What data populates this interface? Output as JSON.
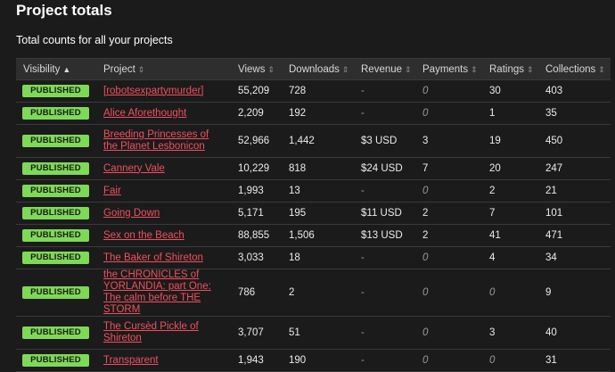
{
  "page": {
    "title": "Project totals",
    "subtitle": "Total counts for all your projects"
  },
  "columns": {
    "visibility": "Visibility",
    "project": "Project",
    "views": "Views",
    "downloads": "Downloads",
    "revenue": "Revenue",
    "payments": "Payments",
    "ratings": "Ratings",
    "collections": "Collections"
  },
  "rows": [
    {
      "status": "PUBLISHED",
      "title": "[robotsexpartymurder]",
      "views": "55,209",
      "downloads": "728",
      "revenue": "-",
      "payments": "0",
      "ratings": "30",
      "collections": "403"
    },
    {
      "status": "PUBLISHED",
      "title": "Alice Aforethought",
      "views": "2,209",
      "downloads": "192",
      "revenue": "-",
      "payments": "0",
      "ratings": "1",
      "collections": "35"
    },
    {
      "status": "PUBLISHED",
      "title": "Breeding Princesses of the Planet Lesbonicon",
      "views": "52,966",
      "downloads": "1,442",
      "revenue": "$3 USD",
      "payments": "3",
      "ratings": "19",
      "collections": "450"
    },
    {
      "status": "PUBLISHED",
      "title": "Cannery Vale",
      "views": "10,229",
      "downloads": "818",
      "revenue": "$24 USD",
      "payments": "7",
      "ratings": "20",
      "collections": "247"
    },
    {
      "status": "PUBLISHED",
      "title": "Fair",
      "views": "1,993",
      "downloads": "13",
      "revenue": "-",
      "payments": "0",
      "ratings": "2",
      "collections": "21"
    },
    {
      "status": "PUBLISHED",
      "title": "Going Down",
      "views": "5,171",
      "downloads": "195",
      "revenue": "$11 USD",
      "payments": "2",
      "ratings": "7",
      "collections": "101"
    },
    {
      "status": "PUBLISHED",
      "title": "Sex on the Beach",
      "views": "88,855",
      "downloads": "1,506",
      "revenue": "$13 USD",
      "payments": "2",
      "ratings": "41",
      "collections": "471"
    },
    {
      "status": "PUBLISHED",
      "title": "The Baker of Shireton",
      "views": "3,033",
      "downloads": "18",
      "revenue": "-",
      "payments": "0",
      "ratings": "4",
      "collections": "34"
    },
    {
      "status": "PUBLISHED",
      "title": "the CHRONICLES of YORLANDIA: part One: The calm before THE STORM",
      "views": "786",
      "downloads": "2",
      "revenue": "-",
      "payments": "0",
      "ratings": "0",
      "collections": "9"
    },
    {
      "status": "PUBLISHED",
      "title": "The Cursèd Pickle of Shireton",
      "views": "3,707",
      "downloads": "51",
      "revenue": "-",
      "payments": "0",
      "ratings": "3",
      "collections": "40"
    },
    {
      "status": "PUBLISHED",
      "title": "Transparent",
      "views": "1,943",
      "downloads": "190",
      "revenue": "-",
      "payments": "0",
      "ratings": "0",
      "collections": "31"
    }
  ],
  "colors": {
    "badge": "#7ed957",
    "link": "#f0505e",
    "background": "#1b1b1b"
  }
}
